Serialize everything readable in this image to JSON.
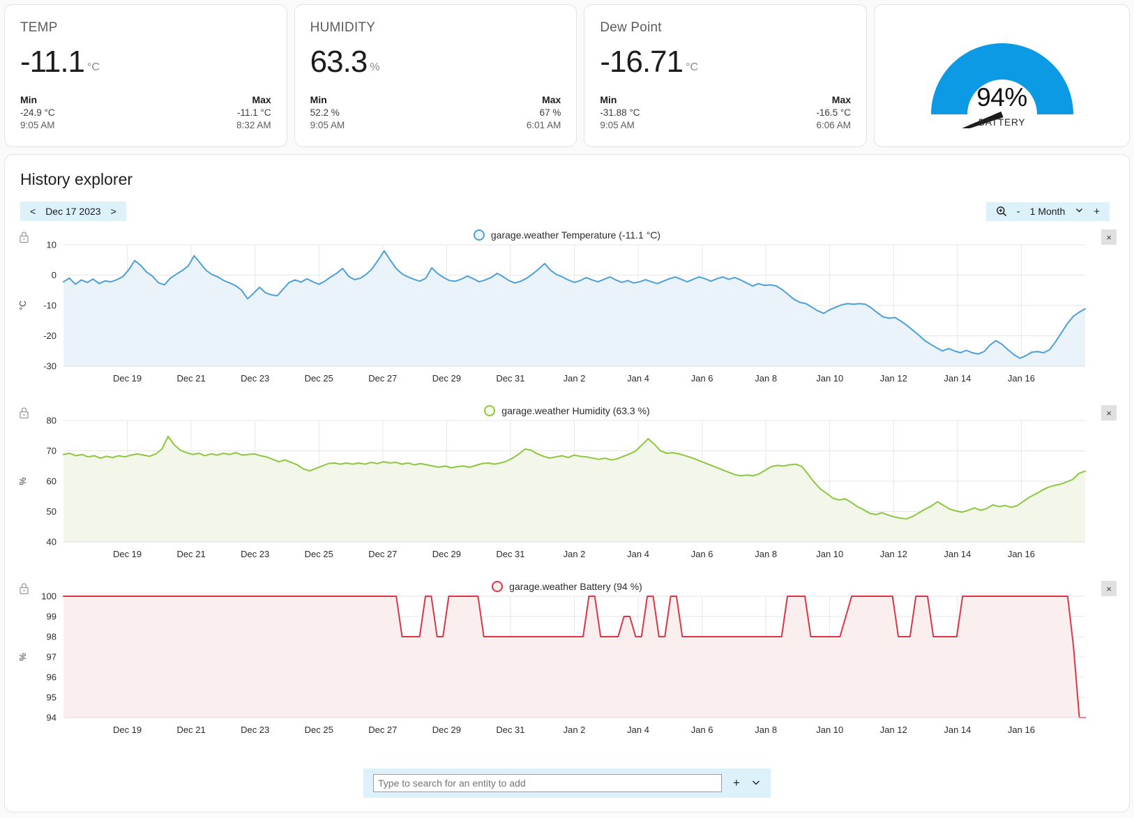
{
  "cards": [
    {
      "title": "TEMP",
      "value": "-11.1",
      "unit": "°C",
      "min_head": "Min",
      "min_value": "-24.9 °C",
      "min_time": "9:05 AM",
      "max_head": "Max",
      "max_value": "-11.1 °C",
      "max_time": "8:32 AM"
    },
    {
      "title": "HUMIDITY",
      "value": "63.3",
      "unit": "%",
      "min_head": "Min",
      "min_value": "52.2 %",
      "min_time": "9:05 AM",
      "max_head": "Max",
      "max_value": "67 %",
      "max_time": "6:01 AM"
    },
    {
      "title": "Dew Point",
      "value": "-16.71",
      "unit": "°C",
      "min_head": "Min",
      "min_value": "-31.88 °C",
      "min_time": "9:05 AM",
      "max_head": "Max",
      "max_value": "-16.5 °C",
      "max_time": "6:06 AM"
    }
  ],
  "gauge": {
    "value_text": "94%",
    "label": "BATTERY",
    "value": 94,
    "min": 0,
    "max": 100,
    "arc_color": "#0d9ae5",
    "needle_color": "#1c1c1c"
  },
  "panel": {
    "title": "History explorer",
    "date_nav": {
      "prev": "<",
      "label": "Dec 17 2023",
      "next": ">"
    },
    "zoom": {
      "icon": "zoom-in-icon",
      "minus": "-",
      "label": "1 Month",
      "chevron": "chevron-down-icon",
      "plus": "+"
    },
    "add_entity": {
      "placeholder": "Type to search for an entity to add",
      "value": "",
      "plus": "+",
      "chevron": "chevron-down-icon"
    },
    "close_label": "×",
    "lock_icon": "lock-icon"
  },
  "chart_data": [
    {
      "type": "line",
      "name": "temperature",
      "title": "garage.weather Temperature (-11.1 °C)",
      "series_name": "garage.weather Temperature",
      "current_value": "-11.1 °C",
      "color": "#4c9fd8",
      "fill_color": "#eaf3fa",
      "ylabel": "°C",
      "ylim": [
        -30,
        10
      ],
      "yticks": [
        10,
        0,
        -10,
        -20,
        -30
      ],
      "xlabel": "",
      "xticks": [
        "Dec 19",
        "Dec 21",
        "Dec 23",
        "Dec 25",
        "Dec 27",
        "Dec 29",
        "Dec 31",
        "Jan 2",
        "Jan 4",
        "Jan 6",
        "Jan 8",
        "Jan 10",
        "Jan 12",
        "Jan 14",
        "Jan 16"
      ],
      "x_start": "Dec 17 2023",
      "x_end": "Jan 16 2024",
      "grid": true,
      "values": [
        -2.2,
        -1.0,
        -3.0,
        -1.6,
        -2.4,
        -1.3,
        -2.8,
        -1.9,
        -2.2,
        -1.5,
        -0.5,
        1.8,
        4.8,
        3.2,
        1.0,
        -0.4,
        -2.5,
        -3.2,
        -1.0,
        0.3,
        1.5,
        3.0,
        6.4,
        4.0,
        1.6,
        0.2,
        -0.6,
        -1.8,
        -2.6,
        -3.5,
        -5.0,
        -7.8,
        -6.0,
        -4.0,
        -5.8,
        -6.5,
        -6.8,
        -4.6,
        -2.4,
        -1.6,
        -2.3,
        -1.2,
        -2.2,
        -3.0,
        -2.0,
        -0.6,
        0.6,
        2.2,
        -0.4,
        -1.5,
        -1.0,
        0.3,
        2.2,
        5.0,
        8.0,
        5.0,
        2.2,
        0.4,
        -0.6,
        -1.4,
        -2.0,
        -1.0,
        2.4,
        0.5,
        -0.8,
        -1.8,
        -2.0,
        -1.3,
        -0.3,
        -1.2,
        -2.2,
        -1.6,
        -0.8,
        0.6,
        -0.5,
        -1.8,
        -2.6,
        -2.0,
        -1.0,
        0.4,
        2.0,
        3.8,
        1.6,
        0.2,
        -0.6,
        -1.6,
        -2.4,
        -1.8,
        -0.8,
        -1.6,
        -2.2,
        -1.4,
        -0.6,
        -1.6,
        -2.4,
        -1.8,
        -2.6,
        -2.2,
        -1.5,
        -2.2,
        -2.8,
        -2.0,
        -1.2,
        -0.6,
        -1.4,
        -2.2,
        -1.4,
        -0.6,
        -1.2,
        -2.0,
        -1.2,
        -0.6,
        -1.4,
        -0.8,
        -1.6,
        -2.6,
        -3.6,
        -2.8,
        -3.4,
        -3.2,
        -3.6,
        -4.8,
        -6.4,
        -8.0,
        -9.0,
        -9.4,
        -10.6,
        -11.8,
        -12.6,
        -11.4,
        -10.6,
        -9.8,
        -9.4,
        -9.6,
        -9.4,
        -9.6,
        -10.8,
        -12.4,
        -13.8,
        -14.2,
        -14.0,
        -15.2,
        -16.6,
        -18.2,
        -19.8,
        -21.6,
        -22.8,
        -24.0,
        -25.0,
        -24.2,
        -25.0,
        -25.6,
        -24.8,
        -25.6,
        -26.0,
        -25.2,
        -23.0,
        -21.6,
        -22.8,
        -24.6,
        -26.2,
        -27.4,
        -26.6,
        -25.4,
        -25.2,
        -25.6,
        -24.6,
        -22.0,
        -19.0,
        -16.0,
        -13.6,
        -12.2,
        -11.1
      ]
    },
    {
      "type": "line",
      "name": "humidity",
      "title": "garage.weather Humidity (63.3 %)",
      "series_name": "garage.weather Humidity",
      "current_value": "63.3 %",
      "color": "#8cc63e",
      "fill_color": "#f2f7e9",
      "ylabel": "%",
      "ylim": [
        40,
        80
      ],
      "yticks": [
        80,
        70,
        60,
        50,
        40
      ],
      "xlabel": "",
      "xticks": [
        "Dec 19",
        "Dec 21",
        "Dec 23",
        "Dec 25",
        "Dec 27",
        "Dec 29",
        "Dec 31",
        "Jan 2",
        "Jan 4",
        "Jan 6",
        "Jan 8",
        "Jan 10",
        "Jan 12",
        "Jan 14",
        "Jan 16"
      ],
      "x_start": "Dec 17 2023",
      "x_end": "Jan 16 2024",
      "grid": true,
      "values": [
        68.8,
        69.2,
        68.4,
        68.8,
        68.0,
        68.4,
        67.6,
        68.2,
        67.8,
        68.4,
        68.0,
        68.6,
        69.0,
        68.6,
        68.2,
        69.0,
        70.6,
        74.8,
        72.0,
        70.2,
        69.4,
        68.8,
        69.2,
        68.4,
        69.0,
        68.6,
        69.2,
        68.8,
        69.4,
        68.6,
        68.8,
        69.0,
        68.4,
        68.0,
        67.2,
        66.4,
        67.0,
        66.2,
        65.4,
        64.0,
        63.4,
        64.2,
        65.0,
        65.8,
        66.0,
        65.6,
        66.0,
        65.6,
        66.0,
        65.6,
        66.2,
        65.8,
        66.4,
        66.0,
        66.2,
        65.6,
        66.0,
        65.4,
        65.8,
        65.4,
        65.0,
        64.6,
        65.0,
        64.4,
        64.8,
        65.0,
        64.6,
        65.2,
        65.8,
        66.0,
        65.6,
        66.0,
        66.6,
        67.6,
        69.0,
        70.6,
        70.2,
        69.0,
        68.2,
        67.6,
        68.0,
        68.4,
        67.8,
        68.6,
        68.2,
        68.0,
        67.6,
        67.2,
        67.6,
        67.0,
        67.4,
        68.2,
        69.0,
        70.0,
        72.0,
        74.0,
        72.2,
        70.0,
        69.2,
        69.4,
        69.0,
        68.4,
        67.8,
        67.0,
        66.2,
        65.4,
        64.6,
        63.8,
        63.0,
        62.2,
        61.8,
        62.0,
        61.8,
        62.4,
        63.6,
        64.8,
        65.2,
        65.0,
        65.4,
        65.6,
        64.8,
        62.2,
        59.6,
        57.4,
        56.0,
        54.4,
        53.8,
        54.2,
        53.0,
        51.6,
        50.6,
        49.4,
        49.0,
        49.6,
        48.8,
        48.2,
        47.8,
        47.6,
        48.4,
        49.6,
        50.8,
        51.8,
        53.2,
        52.0,
        50.8,
        50.2,
        49.8,
        50.4,
        51.2,
        50.4,
        51.0,
        52.2,
        51.6,
        52.0,
        51.4,
        52.0,
        53.4,
        54.8,
        55.8,
        57.0,
        58.0,
        58.6,
        59.0,
        59.8,
        60.6,
        62.6,
        63.3
      ]
    },
    {
      "type": "line",
      "name": "battery",
      "title": "garage.weather Battery (94 %)",
      "series_name": "garage.weather Battery",
      "current_value": "94 %",
      "color": "#dc3545",
      "fill_color": "#fbeeee",
      "ylabel": "%",
      "ylim": [
        94,
        100
      ],
      "yticks": [
        100,
        99,
        98,
        97,
        96,
        95,
        94
      ],
      "xlabel": "",
      "xticks": [
        "Dec 19",
        "Dec 21",
        "Dec 23",
        "Dec 25",
        "Dec 27",
        "Dec 29",
        "Dec 31",
        "Jan 2",
        "Jan 4",
        "Jan 6",
        "Jan 8",
        "Jan 10",
        "Jan 12",
        "Jan 14",
        "Jan 16"
      ],
      "x_start": "Dec 17 2023",
      "x_end": "Jan 16 2024",
      "grid": true,
      "values": [
        100,
        100,
        100,
        100,
        100,
        100,
        100,
        100,
        100,
        100,
        100,
        100,
        100,
        100,
        100,
        100,
        100,
        100,
        100,
        100,
        100,
        100,
        100,
        100,
        100,
        100,
        100,
        100,
        100,
        100,
        100,
        100,
        100,
        100,
        100,
        100,
        100,
        100,
        100,
        100,
        100,
        100,
        100,
        100,
        100,
        100,
        100,
        100,
        100,
        100,
        100,
        100,
        100,
        100,
        100,
        100,
        100,
        100,
        98,
        98,
        98,
        98,
        100,
        100,
        98,
        98,
        100,
        100,
        100,
        100,
        100,
        100,
        98,
        98,
        98,
        98,
        98,
        98,
        98,
        98,
        98,
        98,
        98,
        98,
        98,
        98,
        98,
        98,
        98,
        98,
        100,
        100,
        98,
        98,
        98,
        98,
        99,
        99,
        98,
        98,
        100,
        100,
        98,
        98,
        100,
        100,
        98,
        98,
        98,
        98,
        98,
        98,
        98,
        98,
        98,
        98,
        98,
        98,
        98,
        98,
        98,
        98,
        98,
        98,
        100,
        100,
        100,
        100,
        98,
        98,
        98,
        98,
        98,
        98,
        99,
        100,
        100,
        100,
        100,
        100,
        100,
        100,
        100,
        98,
        98,
        98,
        100,
        100,
        100,
        98,
        98,
        98,
        98,
        98,
        100,
        100,
        100,
        100,
        100,
        100,
        100,
        100,
        100,
        100,
        100,
        100,
        100,
        100,
        100,
        100,
        100,
        100,
        100,
        97.5,
        94,
        94
      ]
    }
  ]
}
